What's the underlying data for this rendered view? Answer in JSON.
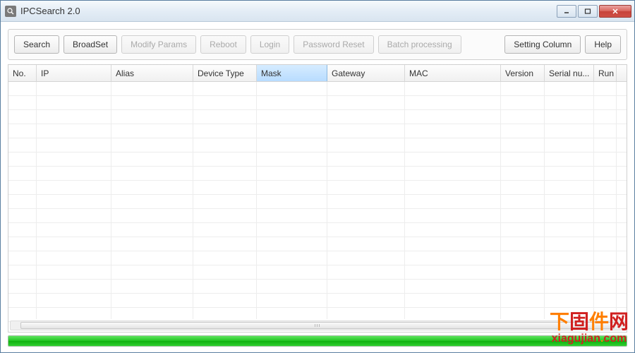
{
  "window": {
    "title": "IPCSearch  2.0"
  },
  "toolbar": {
    "search": "Search",
    "broadset": "BroadSet",
    "modify_params": "Modify Params",
    "reboot": "Reboot",
    "login": "Login",
    "password_reset": "Password Reset",
    "batch_processing": "Batch processing",
    "setting_column": "Setting Column",
    "help": "Help"
  },
  "columns": [
    {
      "key": "no",
      "label": "No.",
      "width": 40
    },
    {
      "key": "ip",
      "label": "IP",
      "width": 106
    },
    {
      "key": "alias",
      "label": "Alias",
      "width": 116
    },
    {
      "key": "device_type",
      "label": "Device Type",
      "width": 90
    },
    {
      "key": "mask",
      "label": "Mask",
      "width": 100,
      "selected": true
    },
    {
      "key": "gateway",
      "label": "Gateway",
      "width": 110
    },
    {
      "key": "mac",
      "label": "MAC",
      "width": 136
    },
    {
      "key": "version",
      "label": "Version",
      "width": 62
    },
    {
      "key": "serial_nu",
      "label": "Serial nu...",
      "width": 70
    },
    {
      "key": "run",
      "label": "Run",
      "width": 32
    }
  ],
  "rows": [],
  "progress": {
    "percent": 100
  },
  "watermark": {
    "cn_line": "下固件网",
    "url_pre": "xiagujian",
    "url_dot": ".",
    "url_post": "com"
  }
}
